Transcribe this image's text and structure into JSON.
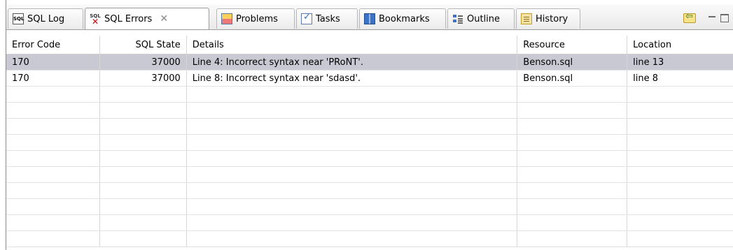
{
  "tabs": [
    {
      "label": "SQL Log",
      "icon": "sql-log-icon"
    },
    {
      "label": "SQL Errors",
      "icon": "sql-errors-icon",
      "active": true,
      "close": "✕"
    },
    {
      "label": "Problems",
      "icon": "problems-icon"
    },
    {
      "label": "Tasks",
      "icon": "tasks-icon"
    },
    {
      "label": "Bookmarks",
      "icon": "bookmarks-icon"
    },
    {
      "label": "Outline",
      "icon": "outline-icon"
    },
    {
      "label": "History",
      "icon": "history-icon"
    }
  ],
  "toolbar": {
    "link": "link-with-editor-icon",
    "minimize": "minimize-icon",
    "maximize": "maximize-icon"
  },
  "table": {
    "columns": [
      "Error Code",
      "SQL State",
      "Details",
      "Resource",
      "Location"
    ],
    "rows": [
      {
        "error_code": "170",
        "sql_state": "37000",
        "details": "Line 4: Incorrect syntax near 'PRoNT'.",
        "resource": "Benson.sql",
        "location": "line 13",
        "selected": true
      },
      {
        "error_code": "170",
        "sql_state": "37000",
        "details": "Line 8: Incorrect syntax near 'sdasd'.",
        "resource": "Benson.sql",
        "location": "line 8",
        "selected": false
      }
    ]
  },
  "colors": {
    "selected_row": "#c9c9d4",
    "error_mark": "#d10000"
  }
}
